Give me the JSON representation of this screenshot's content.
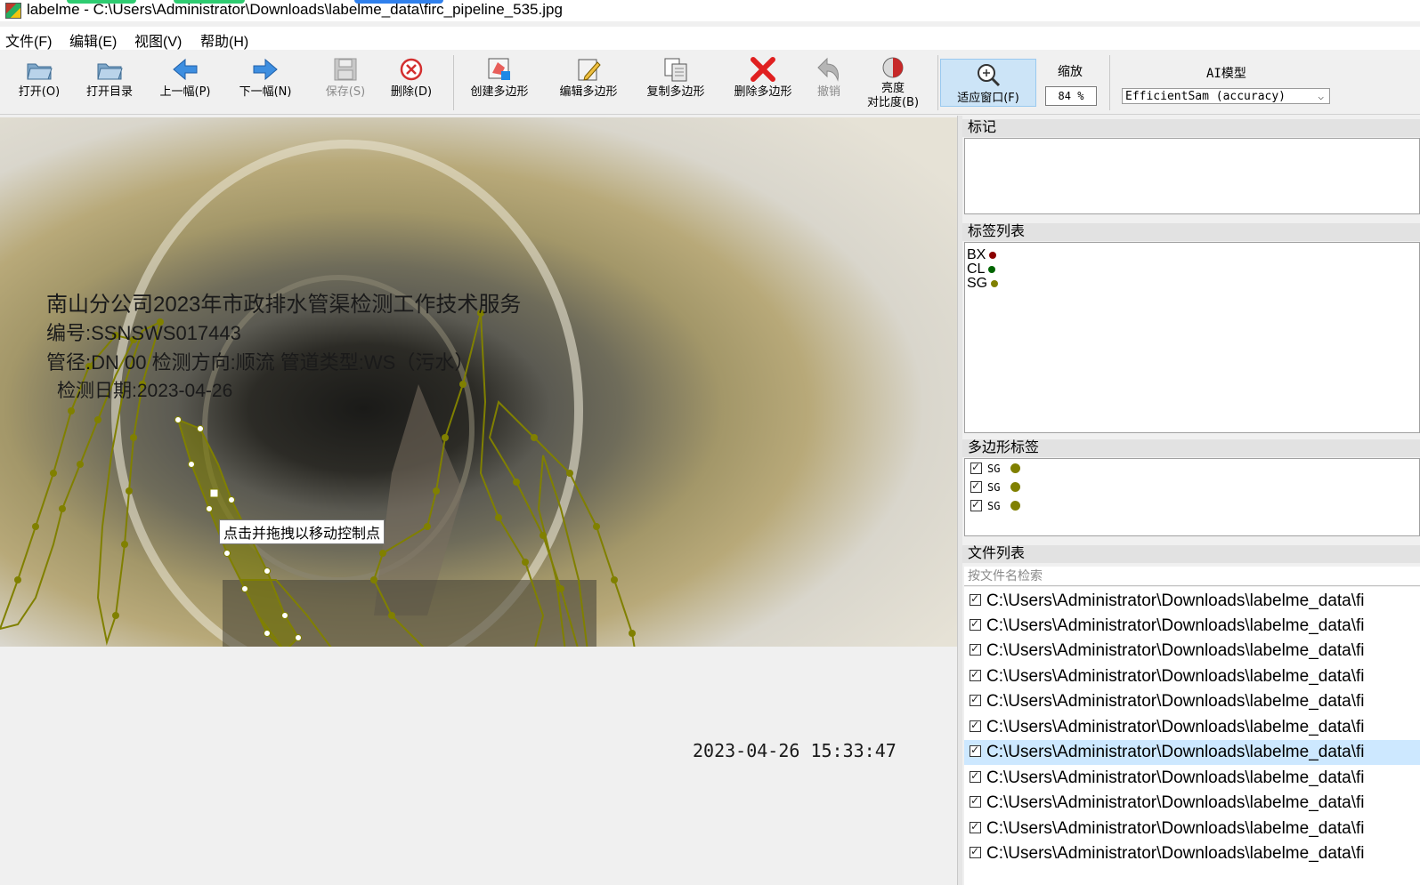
{
  "window": {
    "title": "labelme - C:\\Users\\Administrator\\Downloads\\labelme_data\\firc_pipeline_535.jpg"
  },
  "menu": [
    "文件(F)",
    "编辑(E)",
    "视图(V)",
    "帮助(H)"
  ],
  "toolbar": {
    "open": "打开(O)",
    "open_dir": "打开目录",
    "prev": "上一幅(P)",
    "next": "下一幅(N)",
    "save": "保存(S)",
    "delete": "删除(D)",
    "create_polygon": "创建多边形",
    "edit_polygon": "编辑多边形",
    "copy_polygon": "复制多边形",
    "delete_polygon": "删除多边形",
    "undo": "撤销",
    "brightness_1": "亮度",
    "brightness_2": "对比度(B)",
    "fit_window": "适应窗口(F)",
    "zoom_label": "缩放",
    "zoom_value": "84 %",
    "ai_label": "AI模型",
    "ai_model": "EfficientSam (accuracy)"
  },
  "overlay": {
    "line1": "南山分公司2023年市政排水管渠检测工作技术服务",
    "line2": "编号:SSNSWS017443",
    "line3": "管径:DN 00  检测方向:顺流 管道类型:WS（污水）",
    "line4": "检测日期:2023-04-26",
    "timestamp": "2023-04-26 15:33:47"
  },
  "tooltip": "点击并拖拽以移动控制点",
  "panels": {
    "flags_title": "标记",
    "label_list_title": "标签列表",
    "label_list": [
      {
        "name": "BX",
        "color": "#8b0000"
      },
      {
        "name": "CL",
        "color": "#006400"
      },
      {
        "name": "SG",
        "color": "#808000"
      }
    ],
    "polygon_labels_title": "多边形标签",
    "polygon_labels": [
      {
        "name": "SG",
        "color": "#808000"
      },
      {
        "name": "SG",
        "color": "#808000"
      },
      {
        "name": "SG",
        "color": "#808000"
      }
    ],
    "file_list_title": "文件列表",
    "file_search_placeholder": "按文件名检索",
    "files": [
      "C:\\Users\\Administrator\\Downloads\\labelme_data\\fi",
      "C:\\Users\\Administrator\\Downloads\\labelme_data\\fi",
      "C:\\Users\\Administrator\\Downloads\\labelme_data\\fi",
      "C:\\Users\\Administrator\\Downloads\\labelme_data\\fi",
      "C:\\Users\\Administrator\\Downloads\\labelme_data\\fi",
      "C:\\Users\\Administrator\\Downloads\\labelme_data\\fi",
      "C:\\Users\\Administrator\\Downloads\\labelme_data\\fi",
      "C:\\Users\\Administrator\\Downloads\\labelme_data\\fi",
      "C:\\Users\\Administrator\\Downloads\\labelme_data\\fi",
      "C:\\Users\\Administrator\\Downloads\\labelme_data\\fi",
      "C:\\Users\\Administrator\\Downloads\\labelme_data\\fi"
    ],
    "selected_file_index": 6
  },
  "colors": {
    "polygon": "#808000",
    "selection": "#cde8ff",
    "accent": "#0078d7"
  }
}
